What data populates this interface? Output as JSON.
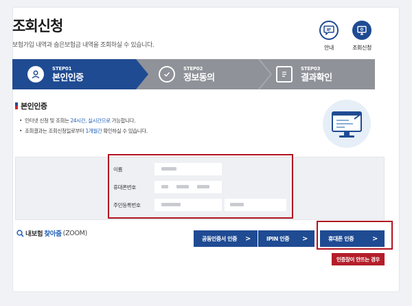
{
  "header": {
    "title": "조회신청",
    "subtitle": "보험가입 내역과 숨은보험금 내역을 조회하실 수 있습니다."
  },
  "top_buttons": [
    {
      "label": "안내",
      "icon": "chat-bubble-icon"
    },
    {
      "label": "조회신청",
      "icon": "monitor-icon"
    }
  ],
  "steps": [
    {
      "num": "STEP01",
      "name": "본인인증",
      "state": "active"
    },
    {
      "num": "STEP02",
      "name": "정보동의",
      "state": "inactive"
    },
    {
      "num": "STEP03",
      "name": "결과확인",
      "state": "inactive"
    }
  ],
  "section": {
    "title": "본인인증",
    "bullet1": {
      "pre": "인터넷 신청 및 조회는 ",
      "hl": "24시간, 실시간으로",
      "post": " 가능합니다."
    },
    "bullet2": {
      "pre": "조회결과는 조회신청일로부터 ",
      "hl": "1개월간",
      "post": " 확인하실 수 있습니다."
    }
  },
  "form": {
    "name_label": "이름",
    "phone_label": "휴대폰번호",
    "rrn_label": "주민등록번호"
  },
  "zoom": {
    "pre": "내보험",
    "blue": "찾아줌",
    "post": "(ZOOM)"
  },
  "buttons": {
    "cert": "공동인증서 인증",
    "ipin": "IPIN 인증",
    "phone": "휴대폰 인증",
    "help": "인증창이 안뜨는 경우",
    "arrow": ">"
  },
  "colors": {
    "primary": "#1f4b93",
    "step_inactive": "#8f9298",
    "highlight_box": "#b1121f",
    "help_button": "#b41e2a"
  }
}
